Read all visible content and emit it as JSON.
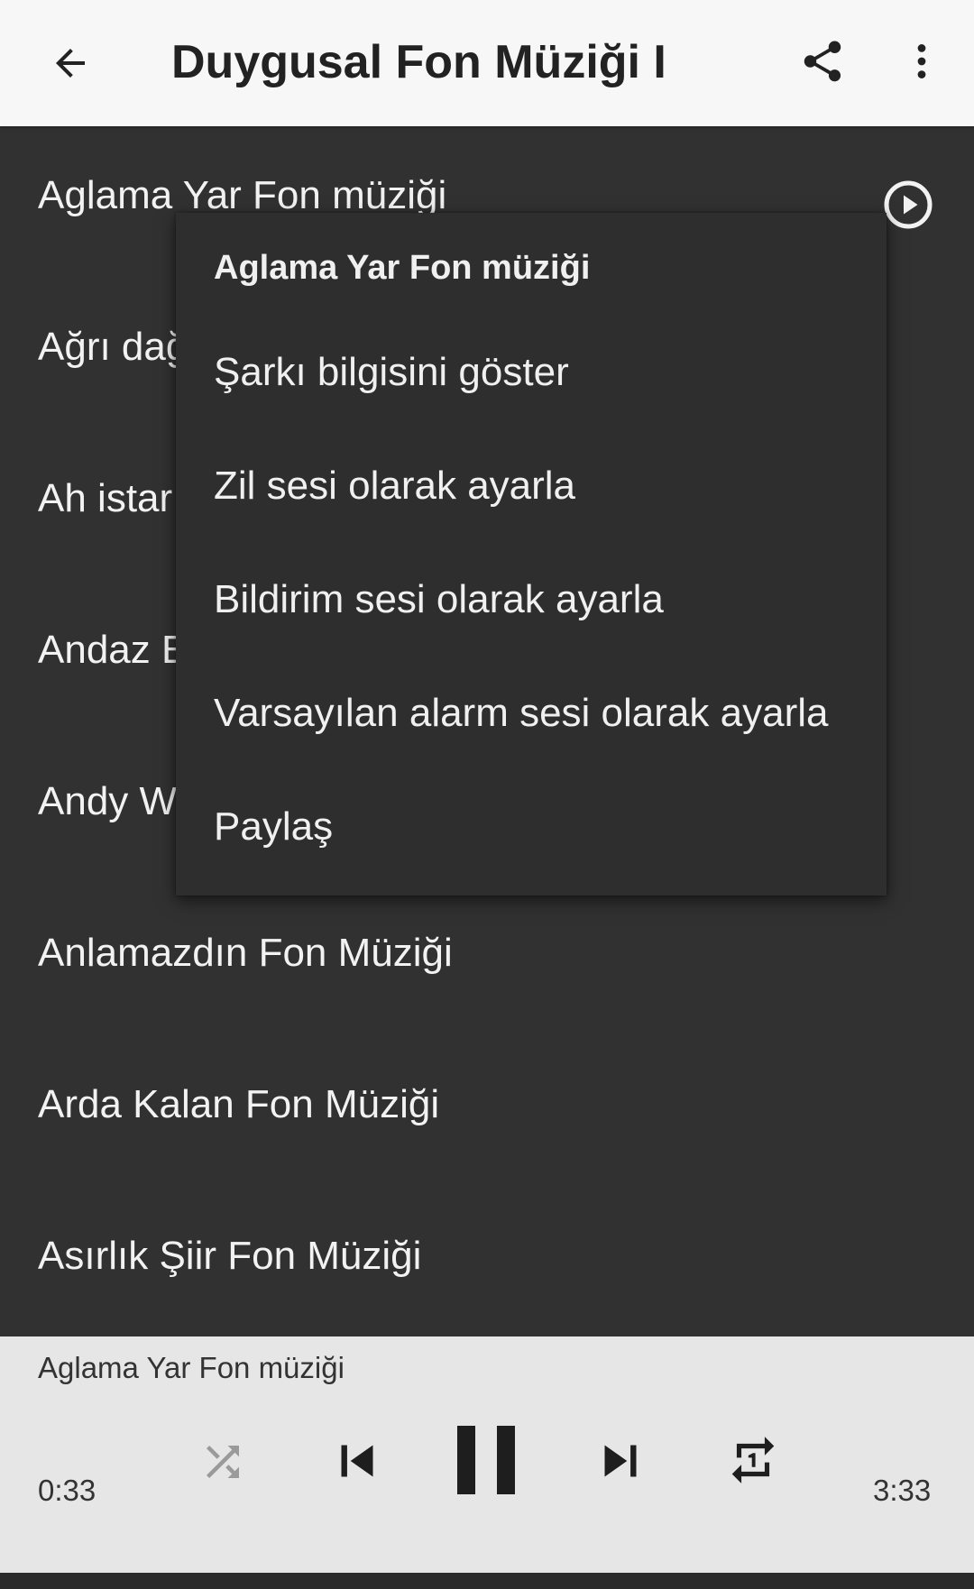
{
  "appbar": {
    "title": "Duygusal Fon Müziği I",
    "back_icon": "arrow-left-icon",
    "share_icon": "share-icon",
    "more_icon": "more-vert-icon"
  },
  "songs": [
    {
      "label": "Aglama Yar Fon müziği",
      "playing": true
    },
    {
      "label": "Ağrı dağ"
    },
    {
      "label": "Ah istar"
    },
    {
      "label": "Andaz E"
    },
    {
      "label": "Andy W"
    },
    {
      "label": "Anlamazdın Fon Müziği"
    },
    {
      "label": "Arda Kalan Fon Müziği"
    },
    {
      "label": "Asırlık Şiir Fon Müziği"
    }
  ],
  "menu": {
    "header": "Aglama Yar Fon müziği",
    "items": [
      {
        "label": "Şarkı bilgisini göster"
      },
      {
        "label": "Zil sesi olarak ayarla"
      },
      {
        "label": "Bildirim sesi olarak ayarla"
      },
      {
        "label": "Varsayılan alarm sesi olarak ayarla"
      },
      {
        "label": "Paylaş"
      }
    ]
  },
  "player": {
    "now_playing": "Aglama Yar Fon müziği",
    "elapsed": "0:33",
    "total": "3:33",
    "shuffle_enabled": false,
    "repeat_mode": "repeat-one",
    "state": "playing"
  },
  "colors": {
    "appbar_bg": "#f7f7f7",
    "list_bg": "#313131",
    "menu_bg": "#2e2e2e",
    "player_bg": "#e6e6e6",
    "text_light": "#f2f2f2",
    "text_dark": "#222222"
  }
}
